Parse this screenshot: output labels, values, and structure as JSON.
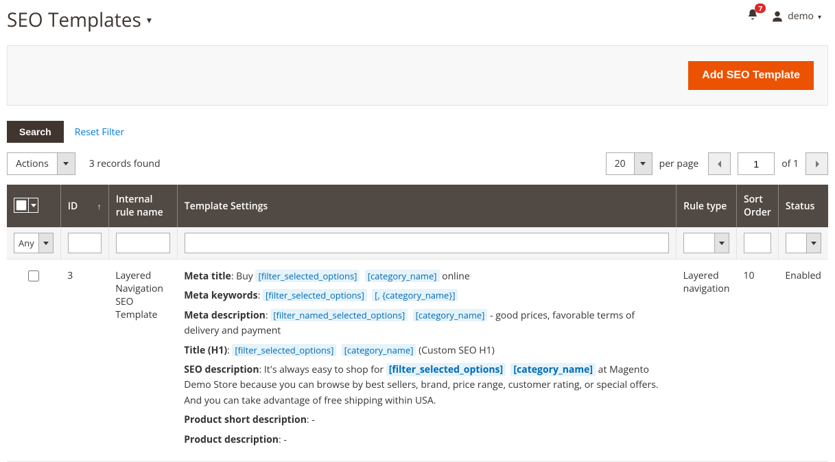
{
  "header": {
    "title": "SEO Templates",
    "notif_count": "7",
    "username": "demo"
  },
  "actions": {
    "add_btn": "Add SEO Template"
  },
  "filter": {
    "search_btn": "Search",
    "reset_link": "Reset Filter"
  },
  "controls": {
    "actions_label": "Actions",
    "records_found": "3 records found",
    "per_page_value": "20",
    "per_page_label": "per page",
    "page_value": "1",
    "page_of": "of 1"
  },
  "columns": {
    "id": "ID",
    "internal_name": "Internal rule name",
    "template_settings": "Template Settings",
    "rule_type": "Rule type",
    "sort_order": "Sort Order",
    "status": "Status"
  },
  "filter_row": {
    "any": "Any"
  },
  "row": {
    "id": "3",
    "name": "Layered Navigation SEO Template",
    "rule_type": "Layered navigation",
    "sort_order": "10",
    "status": "Enabled",
    "settings": {
      "meta_title_label": "Meta title",
      "meta_title_prefix": ": Buy ",
      "meta_title_suffix": " online",
      "meta_keywords_label": "Meta keywords",
      "meta_keywords_sep": ": ",
      "meta_description_label": "Meta description",
      "meta_description_sep": ": ",
      "meta_description_tail": " - good prices, favorable terms of delivery and payment",
      "title_h1_label": "Title (H1)",
      "title_h1_sep": ": ",
      "title_h1_tail": " (Custom SEO H1)",
      "seo_desc_label": "SEO description",
      "seo_desc_pre": ": It's always easy to shop for ",
      "seo_desc_tail": " at Magento Demo Store because you can browse by best sellers, brand, price range, customer rating, or special offers. And you can take advantage of free shipping within USA.",
      "prod_short_label": "Product short description",
      "prod_short_val": ": -",
      "prod_desc_label": "Product description",
      "prod_desc_val": ": -",
      "tok_fso": "[filter_selected_options]",
      "tok_cat": "[category_name]",
      "tok_keywords_cat": "[, {category_name}]",
      "tok_fnso": "[filter_named_selected_options]"
    }
  }
}
